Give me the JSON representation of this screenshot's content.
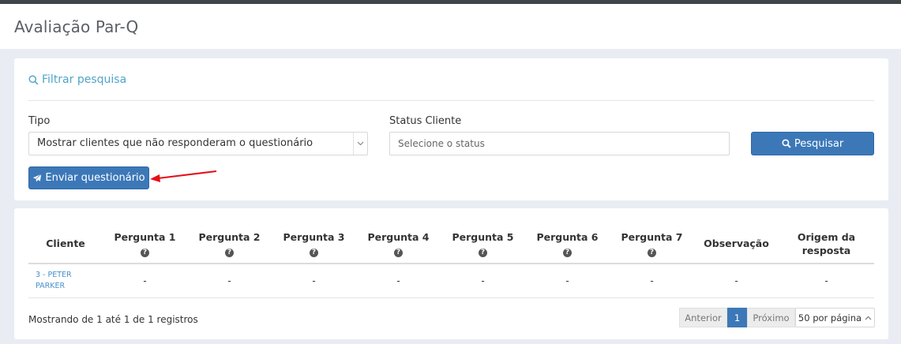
{
  "page": {
    "title": "Avaliação Par-Q"
  },
  "filter": {
    "link_label": "Filtrar pesquisa",
    "tipo_label": "Tipo",
    "tipo_value": "Mostrar clientes que não responderam o questionário",
    "status_label": "Status Cliente",
    "status_placeholder": "Selecione o status",
    "search_button": "Pesquisar",
    "send_button": "Enviar questionário"
  },
  "table": {
    "headers": [
      "Cliente",
      "Pergunta 1",
      "Pergunta 2",
      "Pergunta 3",
      "Pergunta 4",
      "Pergunta 5",
      "Pergunta 6",
      "Pergunta 7",
      "Observação",
      "Origem da resposta"
    ],
    "rows": [
      {
        "cliente": "3 - PETER PARKER",
        "cells": [
          "-",
          "-",
          "-",
          "-",
          "-",
          "-",
          "-",
          "-",
          "-"
        ]
      }
    ],
    "question_icon": "?"
  },
  "footer": {
    "showing": "Mostrando de 1 até 1 de 1 registros",
    "prev": "Anterior",
    "current_page": "1",
    "next": "Próximo",
    "page_size": "50 por página"
  },
  "colors": {
    "accent": "#3c78b8",
    "link": "#4fa5c9",
    "annotation_arrow": "#e3101a"
  }
}
